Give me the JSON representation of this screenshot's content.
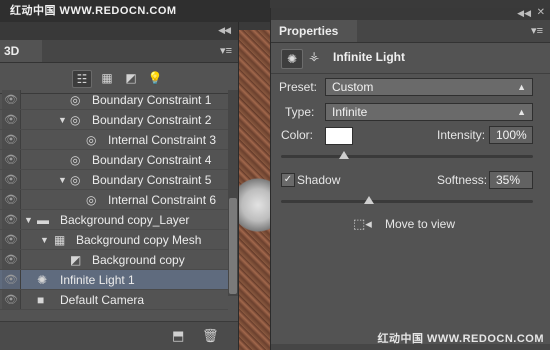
{
  "watermark": {
    "top": "红动中国 WWW.REDOCN.COM",
    "bottom": "红动中国 WWW.REDOCN.COM"
  },
  "panel3d": {
    "title": "3D",
    "tools": [
      "scene-filter-icon",
      "mesh-filter-icon",
      "material-filter-icon",
      "light-filter-icon"
    ],
    "items": [
      {
        "label": "Boundary Constraint 1",
        "icon": "constraint-icon",
        "expanded": false
      },
      {
        "label": "Boundary Constraint 2",
        "icon": "constraint-icon",
        "expanded": true
      },
      {
        "label": "Internal Constraint 3",
        "icon": "constraint-icon",
        "expanded": false
      },
      {
        "label": "Boundary Constraint 4",
        "icon": "constraint-icon",
        "expanded": false
      },
      {
        "label": "Boundary Constraint 5",
        "icon": "constraint-icon",
        "expanded": true
      },
      {
        "label": "Internal Constraint 6",
        "icon": "constraint-icon",
        "expanded": false
      },
      {
        "label": "Background copy_Layer",
        "icon": "folder-icon",
        "expanded": true
      },
      {
        "label": "Background copy Mesh",
        "icon": "mesh-icon",
        "expanded": true
      },
      {
        "label": "Background copy",
        "icon": "material-icon",
        "expanded": false
      },
      {
        "label": "Infinite Light 1",
        "icon": "light-icon",
        "expanded": false,
        "selected": true
      },
      {
        "label": "Default Camera",
        "icon": "camera-icon",
        "expanded": false
      }
    ]
  },
  "properties": {
    "title": "Properties",
    "header_title": "Infinite Light",
    "preset_label": "Preset:",
    "preset_value": "Custom",
    "type_label": "Type:",
    "type_value": "Infinite",
    "color_label": "Color:",
    "color_value": "#ffffff",
    "intensity_label": "Intensity:",
    "intensity_value": "100%",
    "intensity_fraction": 0.25,
    "shadow_label": "Shadow",
    "shadow_checked": true,
    "softness_label": "Softness:",
    "softness_value": "35%",
    "softness_fraction": 0.35,
    "move_to_view": "Move to view"
  }
}
